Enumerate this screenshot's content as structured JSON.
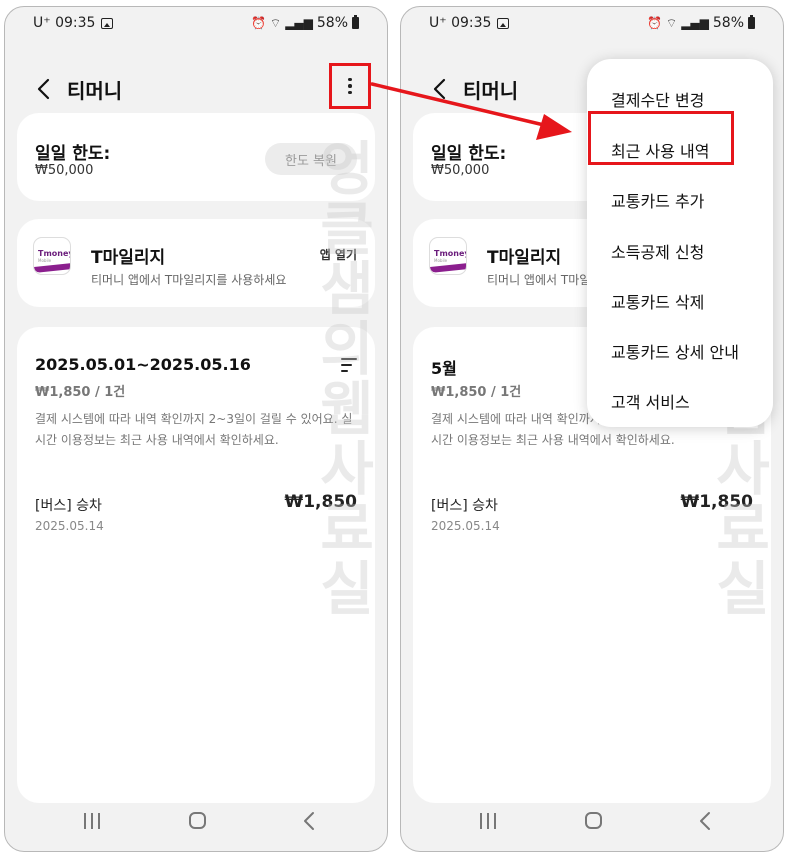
{
  "left": {
    "status": {
      "carrier": "U⁺ 09:35",
      "battery": "58%"
    },
    "header": {
      "title": "티머니"
    },
    "limit": {
      "title": "일일 한도:",
      "value": "₩50,000",
      "button": "한도 복원"
    },
    "mileage": {
      "logo_text": "Tmoney",
      "logo_sub": "Mobile",
      "title": "T마일리지",
      "desc": "티머니 앱에서 T마일리지를 사용하세요",
      "link": "앱 열기"
    },
    "history": {
      "period": "2025.05.01~2025.05.16",
      "summary": "₩1,850 / 1건",
      "notice": "결제 시스템에 따라 내역 확인까지 2~3일이 걸릴 수 있어요. 실시간 이용정보는 최근 사용 내역에서 확인하세요.",
      "txn": {
        "title": "[버스] 승차",
        "date": "2025.05.14",
        "amount": "₩1,850"
      }
    },
    "watermark": "엉클샘의웹사료실"
  },
  "right": {
    "status": {
      "carrier": "U⁺ 09:35",
      "battery": "58%"
    },
    "header": {
      "title": "티머니"
    },
    "limit": {
      "title": "일일 한도:",
      "value": "₩50,000"
    },
    "mileage": {
      "logo_text": "Tmoney",
      "logo_sub": "Mobile",
      "title": "T마일리지",
      "desc": "티머니 앱에서 T마일리지를 사용하세요"
    },
    "history": {
      "period": "5월",
      "summary": "₩1,850 / 1건",
      "notice": "결제 시스템에 따라 내역 확인까지 2~3일이 걸릴 수 있어요. 실시간 이용정보는 최근 사용 내역에서 확인하세요.",
      "txn": {
        "title": "[버스] 승차",
        "date": "2025.05.14",
        "amount": "₩1,850"
      }
    },
    "menu": {
      "items": [
        "결제수단 변경",
        "최근 사용 내역",
        "교통카드 추가",
        "소득공제 신청",
        "교통카드 삭제",
        "교통카드 상세 안내",
        "고객 서비스"
      ]
    },
    "watermark": "엉클샘의웹사료실"
  },
  "colors": {
    "highlight": "#e6161b",
    "background": "#f2f2f2",
    "card": "#ffffff"
  }
}
